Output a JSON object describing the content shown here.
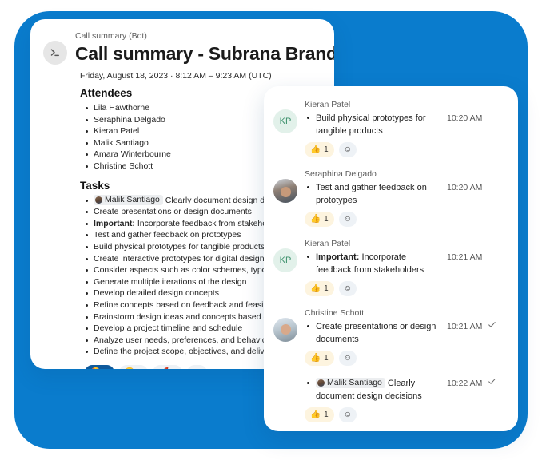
{
  "theme": {
    "frame_blue": "#0a7ccd",
    "card_white": "#ffffff",
    "active_pill_blue": "#0f5a9c",
    "thumb_pill_yellow": "#fdf4df",
    "avatar_mint": "#e2f1ea"
  },
  "summary_card": {
    "bot_label": "Call summary (Bot)",
    "bot_icon": "terminal-prompt-icon",
    "title": "Call summary - Subrana Brand",
    "meta": "Friday, August 18, 2023  ·  8:12 AM – 9:23 AM (UTC)",
    "attendees_heading": "Attendees",
    "attendees": [
      "Lila Hawthorne",
      "Seraphina Delgado",
      "Kieran Patel",
      "Malik Santiago",
      "Amara Winterbourne",
      "Christine Schott"
    ],
    "tasks_heading": "Tasks",
    "tasks": [
      {
        "mention": "Malik Santiago",
        "text": "Clearly document design decisions"
      },
      {
        "text": "Create presentations or design documents"
      },
      {
        "bold_prefix": "Important:",
        "text": "Incorporate feedback from stakeholders"
      },
      {
        "text": "Test and gather feedback on prototypes"
      },
      {
        "text": "Build physical prototypes for tangible products"
      },
      {
        "text": "Create interactive prototypes for digital designs"
      },
      {
        "text": "Consider aspects such as color schemes, typography"
      },
      {
        "text": "Generate multiple iterations of the design"
      },
      {
        "text": "Develop detailed design concepts"
      },
      {
        "text": "Refine concepts based on feedback and feasibility"
      },
      {
        "text": "Brainstorm design ideas and concepts based on research"
      },
      {
        "text": "Develop a project timeline and schedule"
      },
      {
        "text": "Analyze user needs, preferences, and behaviors"
      },
      {
        "text": "Define the project scope, objectives, and deliverables"
      }
    ],
    "reactions": [
      {
        "emoji": "🤩",
        "icon": "star-struck-reaction",
        "count": "3",
        "active": true
      },
      {
        "emoji": "😎",
        "icon": "sunglasses-reaction",
        "count": "1",
        "active": false
      },
      {
        "emoji": "🚀",
        "icon": "rocket-reaction",
        "count": "1",
        "active": false
      },
      {
        "emoji": "☺",
        "icon": "add-reaction-icon",
        "count": "",
        "active": false
      }
    ]
  },
  "thread_card": {
    "messages": [
      {
        "author": "Kieran Patel",
        "avatar_type": "initials",
        "avatar_initials": "KP",
        "text": "Build physical prototypes for tangible products",
        "time": "10:20 AM",
        "checked": false,
        "indented": false,
        "reactions": [
          {
            "emoji": "👍",
            "icon": "thumbs-up-reaction",
            "count": "1",
            "style": "thumb"
          },
          {
            "emoji": "☺",
            "icon": "add-reaction-icon",
            "count": "",
            "style": "addrx"
          }
        ]
      },
      {
        "author": "Seraphina Delgado",
        "avatar_type": "photo-a",
        "avatar_initials": "",
        "text": "Test and gather feedback on prototypes",
        "time": "10:20 AM",
        "checked": false,
        "indented": false,
        "reactions": [
          {
            "emoji": "👍",
            "icon": "thumbs-up-reaction",
            "count": "1",
            "style": "thumb"
          },
          {
            "emoji": "☺",
            "icon": "add-reaction-icon",
            "count": "",
            "style": "addrx"
          }
        ]
      },
      {
        "author": "Kieran Patel",
        "avatar_type": "initials",
        "avatar_initials": "KP",
        "bold_prefix": "Important:",
        "text": "Incorporate feedback from stakeholders",
        "time": "10:21 AM",
        "checked": false,
        "indented": false,
        "reactions": [
          {
            "emoji": "👍",
            "icon": "thumbs-up-reaction",
            "count": "1",
            "style": "thumb"
          },
          {
            "emoji": "☺",
            "icon": "add-reaction-icon",
            "count": "",
            "style": "addrx"
          }
        ]
      },
      {
        "author": "Christine Schott",
        "avatar_type": "photo-b",
        "avatar_initials": "",
        "text": "Create presentations or design documents",
        "time": "10:21 AM",
        "checked": true,
        "indented": false,
        "reactions": [
          {
            "emoji": "👍",
            "icon": "thumbs-up-reaction",
            "count": "1",
            "style": "thumb"
          },
          {
            "emoji": "☺",
            "icon": "add-reaction-icon",
            "count": "",
            "style": "addrx"
          }
        ]
      },
      {
        "author": "",
        "avatar_type": "none",
        "avatar_initials": "",
        "mention": "Malik Santiago",
        "text": "Clearly document design decisions",
        "time": "10:22 AM",
        "checked": true,
        "indented": true,
        "reactions": [
          {
            "emoji": "👍",
            "icon": "thumbs-up-reaction",
            "count": "1",
            "style": "thumb"
          },
          {
            "emoji": "☺",
            "icon": "add-reaction-icon",
            "count": "",
            "style": "addrx"
          }
        ]
      }
    ]
  }
}
